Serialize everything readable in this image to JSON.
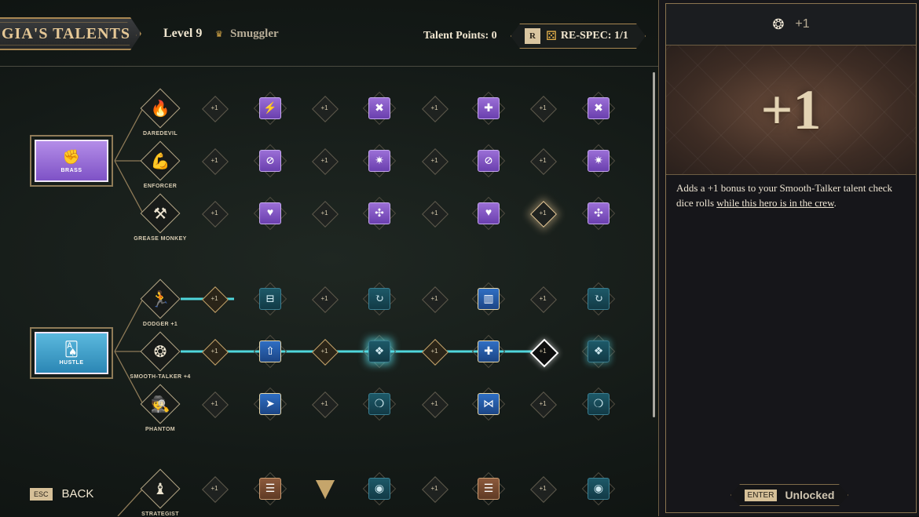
{
  "header": {
    "title": "GIA'S TALENTS",
    "level": "Level 9",
    "class_icon": "crown-icon",
    "class_name": "Smuggler",
    "talent_points": "Talent Points: 0",
    "respec_key": "R",
    "respec_icon": "dice-icon",
    "respec_label": "RE-SPEC: 1/1"
  },
  "colors": {
    "brass": "#8b5fd0",
    "hustle": "#3b9cc4",
    "active_line": "#4fd6dc",
    "gold_border": "#a88752"
  },
  "tree": {
    "categories": [
      {
        "name": "BRASS",
        "icon": "fist-icon"
      },
      {
        "name": "HUSTLE",
        "icon": "cards-icon"
      }
    ],
    "rows": [
      {
        "name": "DAREDEVIL",
        "icon": "flame-icon",
        "small": [
          "+1",
          "+1",
          "+1",
          "+1"
        ],
        "icons": [
          "card-bolt",
          "x-boost",
          "card-plus",
          "x-boost"
        ],
        "style": "purple",
        "active": 0
      },
      {
        "name": "ENFORCER",
        "icon": "muscle-icon",
        "small": [
          "+1",
          "+1",
          "+1",
          "+1"
        ],
        "icons": [
          "shield-slash",
          "shatter",
          "shield-slash",
          "shatter"
        ],
        "style": "purple",
        "active": 0
      },
      {
        "name": "GREASE MONKEY",
        "icon": "wrench-icon",
        "small": [
          "+1",
          "+1",
          "+1",
          "+1"
        ],
        "icons": [
          "heart-plus",
          "gear-cross",
          "heart-plus",
          "gear-cross"
        ],
        "style": "purple",
        "active": 0
      },
      {
        "name": "DODGER +1",
        "icon": "runner-icon",
        "small": [
          "+1",
          "+1",
          "+1",
          "+1"
        ],
        "icons": [
          "vault",
          "cycle",
          "cage",
          "cycle"
        ],
        "style": "teal",
        "active": 1
      },
      {
        "name": "SMOOTH-TALKER +4",
        "icon": "talker-icon",
        "small": [
          "+1",
          "+1",
          "+1",
          "+1"
        ],
        "icons": [
          "card-up",
          "rune",
          "card-plus",
          "rune"
        ],
        "style": "smooth",
        "active": 4
      },
      {
        "name": "PHANTOM",
        "icon": "spy-icon",
        "small": [
          "+1",
          "+1",
          "+1",
          "+1"
        ],
        "icons": [
          "dart",
          "brain",
          "dart-plus",
          "brain"
        ],
        "style": "teal-p",
        "active": 0
      },
      {
        "name": "STRATEGIST",
        "icon": "chess-icon",
        "small": [
          "+1",
          "",
          "+1",
          "+1"
        ],
        "icons": [
          "stack",
          "orb",
          "stack",
          "orb"
        ],
        "style": "rust",
        "active": 0
      }
    ]
  },
  "footer": {
    "back_key": "ESC",
    "back_label": "BACK"
  },
  "panel": {
    "head_icon": "talker-icon",
    "head_text": "+1",
    "hero_text": "+1",
    "desc_start": "Adds a +1 bonus to your Smooth-Talker talent check dice rolls ",
    "desc_link": "while this hero is in the crew",
    "desc_end": ".",
    "enter_key": "ENTER",
    "unlock_label": "Unlocked"
  }
}
